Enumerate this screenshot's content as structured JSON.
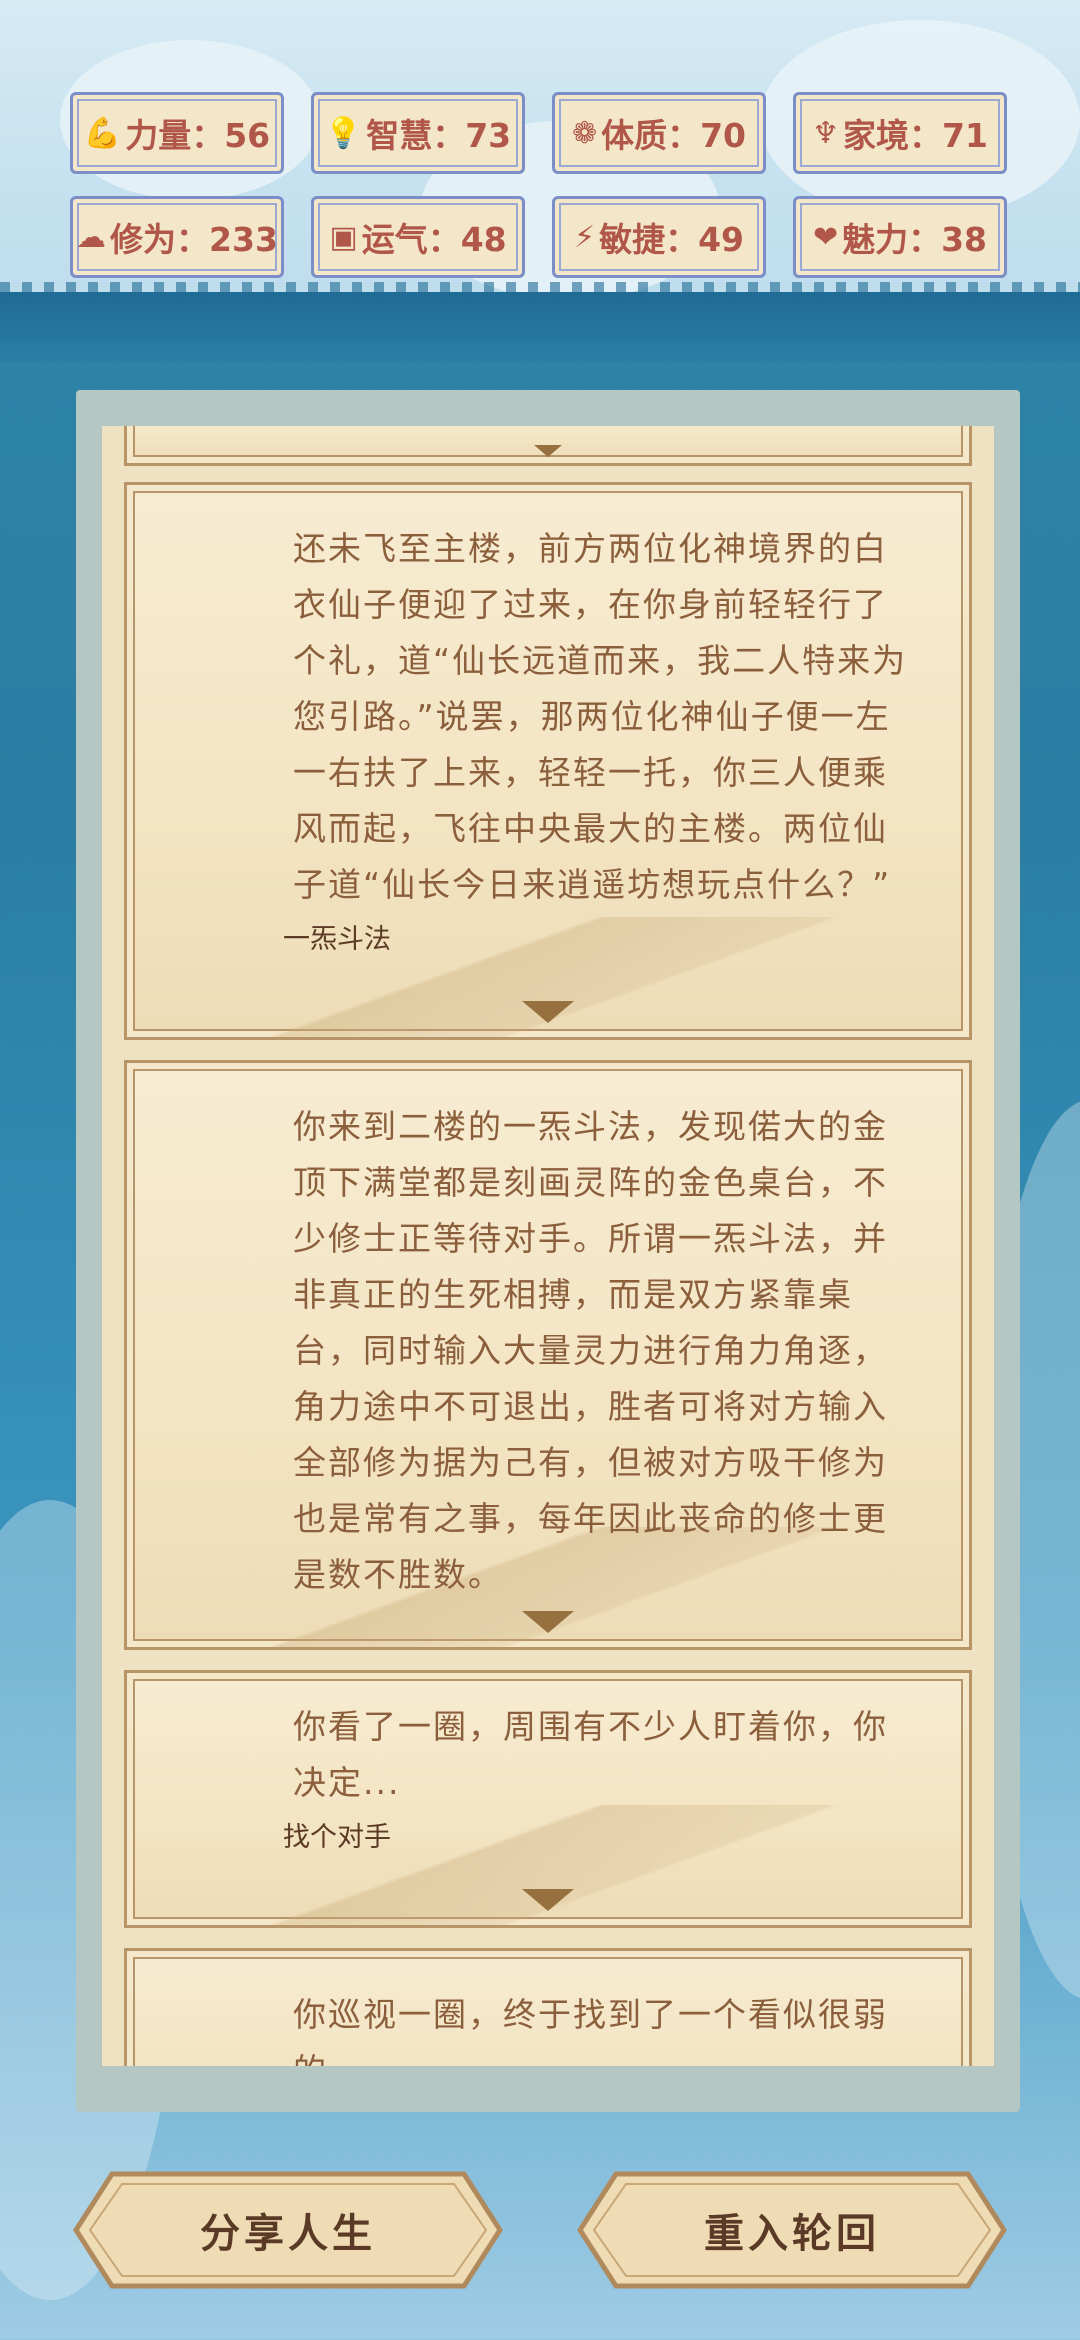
{
  "stats": [
    {
      "icon": "muscle-icon",
      "glyph": "💪",
      "label": "力量：56"
    },
    {
      "icon": "bulb-icon",
      "glyph": "💡",
      "label": "智慧：73"
    },
    {
      "icon": "heartbeat-icon",
      "glyph": "❁",
      "label": "体质：70"
    },
    {
      "icon": "money-bag-icon",
      "glyph": "♆",
      "label": "家境：71"
    },
    {
      "icon": "cloud-icon",
      "glyph": "☁",
      "label": "修为：233"
    },
    {
      "icon": "luck-icon",
      "glyph": "▣",
      "label": "运气：48"
    },
    {
      "icon": "lightning-icon",
      "glyph": "⚡",
      "label": "敏捷：49"
    },
    {
      "icon": "heart-icon",
      "glyph": "❤",
      "label": "魅力：38"
    }
  ],
  "cards": [
    {
      "text": "还未飞至主楼，前方两位化神境界的白衣仙子便迎了过来，在你身前轻轻行了个礼，道“仙长远道而来，我二人特来为您引路。”说罢，那两位化神仙子便一左一右扶了上来，轻轻一托，你三人便乘风而起，飞往中央最大的主楼。两位仙子道“仙长今日来逍遥坊想玩点什么？”",
      "choice": "一炁斗法"
    },
    {
      "text": "你来到二楼的一炁斗法，发现偌大的金顶下满堂都是刻画灵阵的金色桌台，不少修士正等待对手。所谓一炁斗法，并非真正的生死相搏，而是双方紧靠桌台，同时输入大量灵力进行角力角逐，角力途中不可退出，胜者可将对方输入全部修为据为己有，但被对方吸干修为也是常有之事，每年因此丧命的修士更是数不胜数。",
      "choice": ""
    },
    {
      "text": "你看了一圈，周围有不少人盯着你，你决定...",
      "choice": "找个对手"
    },
    {
      "text": "你巡视一圈，终于找到了一个看似很弱的",
      "choice": ""
    }
  ],
  "buttons": {
    "share": "分享人生",
    "reincarnate": "重入轮回"
  },
  "colors": {
    "stat_text": "#b0574a",
    "stat_border": "#7c8ec8",
    "card_bg": "#f3e4c3",
    "card_text": "#8b5e3c"
  }
}
